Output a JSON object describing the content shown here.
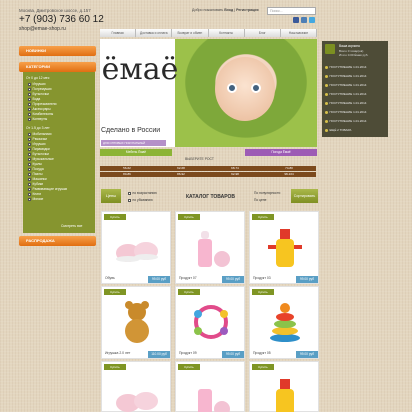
{
  "header": {
    "address": "Москва, Дмитровское шоссе, д.157",
    "phone": "+7 (903) 736 60 12",
    "email": "shop@emae-shop.ru",
    "welcome": "Добро пожаловать",
    "login": "Вход",
    "register": "Регистрация",
    "search_placeholder": "Поиск..."
  },
  "menu": [
    "Главная",
    "Доставка и оплата",
    "Возврат и обмен",
    "Контакты",
    "Блог",
    "Наш магазин"
  ],
  "sidebar": {
    "new_label": "НОВИНКИ",
    "categories_label": "КАТЕГОРИИ",
    "group1": "От 0 до 12 мес",
    "items1": [
      "Игрушки",
      "Погремушки",
      "Бутылочки",
      "Вода",
      "Прорезыватели",
      "Аксессуары",
      "Комбинезоны",
      "Конверты"
    ],
    "group2": "От 1.5 до 3 лет",
    "items2": [
      "Мобильники",
      "Рюкзачки",
      "Игрушки",
      "Пирамидки",
      "Бутылочки",
      "Музыкальные",
      "Куклы",
      "Посуда",
      "Пазлы",
      "Машинки",
      "Кубики",
      "Развивающие игрушки",
      "Книги",
      "Мягкие"
    ],
    "submit": "Смотреть все",
    "sale_label": "РАСПРОДАЖА"
  },
  "banner": {
    "logo": "ёмаё",
    "tagline": "Сделано в России",
    "subline": "ДЛЯ ОПТОВЫХ ПОКУПАТЕЛЕЙ",
    "tab_left": "Мебель Ёмаё",
    "tab_right": "Погода Ёмаё"
  },
  "ages": {
    "title": "ВЫБЕРИТЕ РОСТ",
    "cells": [
      "56-62",
      "62-68",
      "68-74",
      "74-80",
      "80-86",
      "86-92",
      "92-98",
      "98-104"
    ]
  },
  "catalog": {
    "left_button": "Цены",
    "sort1": "по возрастанию",
    "sort2": "по убыванию",
    "title": "КАТАЛОГ ТОВАРОВ",
    "right_sel1": "По популярности",
    "right_sel2": "По цене",
    "right_button": "Сортировать"
  },
  "products": [
    {
      "buy": "Купить",
      "name": "Обувь",
      "price": "99.00 руб"
    },
    {
      "buy": "Купить",
      "name": "Продукт 07",
      "price": "99.00 руб"
    },
    {
      "buy": "Купить",
      "name": "Продукт 03",
      "price": "99.00 руб"
    },
    {
      "buy": "Купить",
      "name": "Игрушка 2.0 лет",
      "price": "110.00 руб"
    },
    {
      "buy": "Купить",
      "name": "Продукт 09",
      "price": "99.00 руб"
    },
    {
      "buy": "Купить",
      "name": "Продукт 05",
      "price": "99.00 руб"
    },
    {
      "buy": "Купить",
      "name": "",
      "price": ""
    },
    {
      "buy": "Купить",
      "name": "",
      "price": ""
    },
    {
      "buy": "Купить",
      "name": "",
      "price": ""
    }
  ],
  "cart": {
    "title": "Ваша корзина",
    "line1": "Всего 0 товар(ов)",
    "line2": "Итого 0.00 Ёмаё руб.",
    "news": [
      "ПОСТУПЛЕНИЕ 1.01.2014",
      "ПОСТУПЛЕНИЕ 1.01.2014",
      "ПОСТУПЛЕНИЕ 1.01.2014",
      "ПОСТУПЛЕНИЕ 1.01.2014",
      "ПОСТУПЛЕНИЕ 1.01.2014",
      "ПОСТУПЛЕНИЕ 1.01.2014",
      "ПОСТУПЛЕНИЕ 1.01.2014",
      "ПОСТУПЛЕНИЕ 1.01.2014"
    ],
    "news_tail": "ЕЩЁ 2 ТОВАРА"
  }
}
